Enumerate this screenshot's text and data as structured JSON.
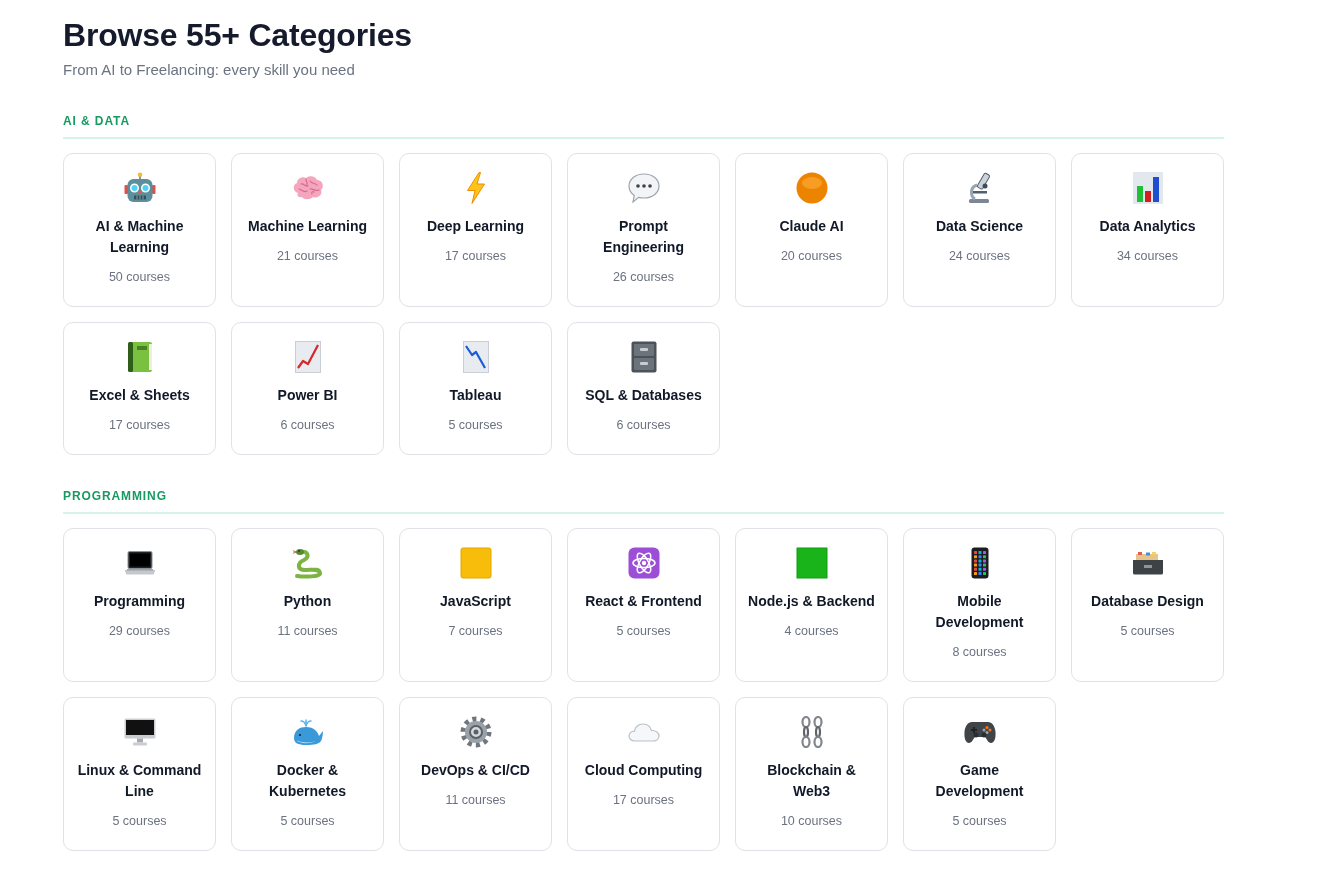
{
  "page": {
    "title": "Browse 55+ Categories",
    "subtitle": "From AI to Freelancing: every skill you need"
  },
  "sections": [
    {
      "label": "AI & DATA",
      "categories": [
        {
          "name": "AI & Machine Learning",
          "count": "50 courses"
        },
        {
          "name": "Machine Learning",
          "count": "21 courses"
        },
        {
          "name": "Deep Learning",
          "count": "17 courses"
        },
        {
          "name": "Prompt Engineering",
          "count": "26 courses"
        },
        {
          "name": "Claude AI",
          "count": "20 courses"
        },
        {
          "name": "Data Science",
          "count": "24 courses"
        },
        {
          "name": "Data Analytics",
          "count": "34 courses"
        },
        {
          "name": "Excel & Sheets",
          "count": "17 courses"
        },
        {
          "name": "Power BI",
          "count": "6 courses"
        },
        {
          "name": "Tableau",
          "count": "5 courses"
        },
        {
          "name": "SQL & Databases",
          "count": "6 courses"
        }
      ]
    },
    {
      "label": "PROGRAMMING",
      "categories": [
        {
          "name": "Programming",
          "count": "29 courses"
        },
        {
          "name": "Python",
          "count": "11 courses"
        },
        {
          "name": "JavaScript",
          "count": "7 courses"
        },
        {
          "name": "React & Frontend",
          "count": "5 courses"
        },
        {
          "name": "Node.js & Backend",
          "count": "4 courses"
        },
        {
          "name": "Mobile Development",
          "count": "8 courses"
        },
        {
          "name": "Database Design",
          "count": "5 courses"
        },
        {
          "name": "Linux & Command Line",
          "count": "5 courses"
        },
        {
          "name": "Docker & Kubernetes",
          "count": "5 courses"
        },
        {
          "name": "DevOps & CI/CD",
          "count": "11 courses"
        },
        {
          "name": "Cloud Computing",
          "count": "17 courses"
        },
        {
          "name": "Blockchain & Web3",
          "count": "10 courses"
        },
        {
          "name": "Game Development",
          "count": "5 courses"
        }
      ]
    }
  ]
}
